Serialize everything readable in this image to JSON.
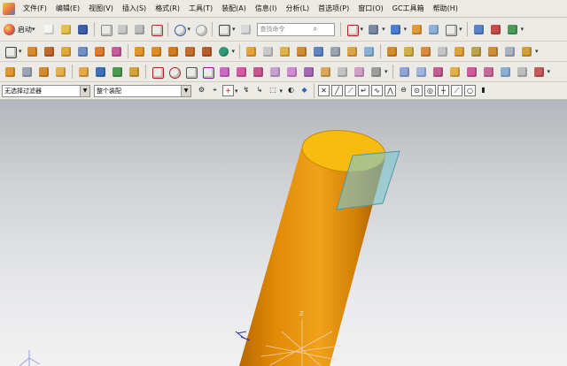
{
  "menu": [
    "文件(F)",
    "编辑(E)",
    "视图(V)",
    "插入(S)",
    "格式(R)",
    "工具(T)",
    "装配(A)",
    "信息(I)",
    "分析(L)",
    "首选项(P)",
    "窗口(O)",
    "GC工具箱",
    "帮助(H)"
  ],
  "toolbar": {
    "start_label": "启动",
    "search_placeholder": "查找命令"
  },
  "filter": {
    "selection_filter": "无选择过滤器",
    "assembly_scope": "整个装配"
  },
  "viewport": {
    "cylinder_color": "#e8940e",
    "cap_color": "#f7bf12",
    "plane_color": "#7fc6cf",
    "wcs_label": "Z"
  }
}
